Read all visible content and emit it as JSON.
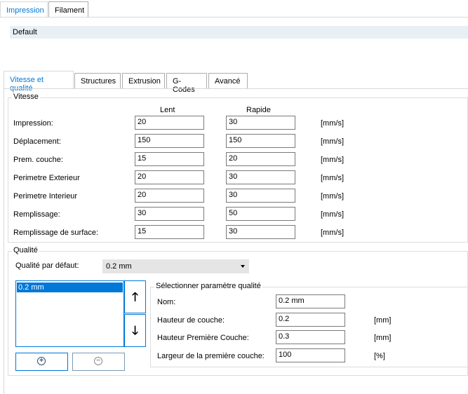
{
  "top_tabs": [
    {
      "label": "Impression",
      "active": true
    },
    {
      "label": "Filament",
      "active": false
    }
  ],
  "profile": {
    "name": "Default"
  },
  "sub_tabs": [
    {
      "label": "Vitesse et qualité",
      "active": true
    },
    {
      "label": "Structures",
      "active": false
    },
    {
      "label": "Extrusion",
      "active": false
    },
    {
      "label": "G-Codes",
      "active": false
    },
    {
      "label": "Avancé",
      "active": false
    }
  ],
  "vitesse": {
    "title": "Vitesse",
    "col_slow": "Lent",
    "col_fast": "Rapide",
    "rows": [
      {
        "label": "Impression:",
        "slow": "20",
        "fast": "30",
        "unit": "[mm/s]"
      },
      {
        "label": "Déplacement:",
        "slow": "150",
        "fast": "150",
        "unit": "[mm/s]"
      },
      {
        "label": "Prem. couche:",
        "slow": "15",
        "fast": "20",
        "unit": "[mm/s]"
      },
      {
        "label": "Perimetre Exterieur",
        "slow": "20",
        "fast": "30",
        "unit": "[mm/s]"
      },
      {
        "label": "Perimetre Interieur",
        "slow": "20",
        "fast": "30",
        "unit": "[mm/s]"
      },
      {
        "label": "Remplissage:",
        "slow": "30",
        "fast": "50",
        "unit": "[mm/s]"
      },
      {
        "label": "Remplissage de surface:",
        "slow": "15",
        "fast": "30",
        "unit": "[mm/s]"
      }
    ]
  },
  "qualite": {
    "title": "Qualité",
    "default_label": "Qualité par défaut:",
    "default_value": "0.2 mm",
    "list_items": [
      "0.2 mm"
    ],
    "params": {
      "title": "Sélectionner paramètre qualité",
      "rows": [
        {
          "label": "Nom:",
          "value": "0.2 mm",
          "unit": ""
        },
        {
          "label": "Hauteur de couche:",
          "value": "0.2",
          "unit": "[mm]"
        },
        {
          "label": "Hauteur Première Couche:",
          "value": "0.3",
          "unit": "[mm]"
        },
        {
          "label": "Largeur de la première couche:",
          "value": "100",
          "unit": "[%]"
        }
      ]
    },
    "up_glyph": "🡑",
    "down_glyph": "🡓",
    "add_glyph": "+",
    "remove_glyph": "−"
  },
  "colors": {
    "accent": "#0078d7",
    "profile_bar": "#e8f0f5"
  },
  "icons": [
    "arrow-up-icon",
    "arrow-down-icon",
    "add-circle-icon",
    "remove-circle-icon",
    "dropdown-arrow-icon"
  ]
}
